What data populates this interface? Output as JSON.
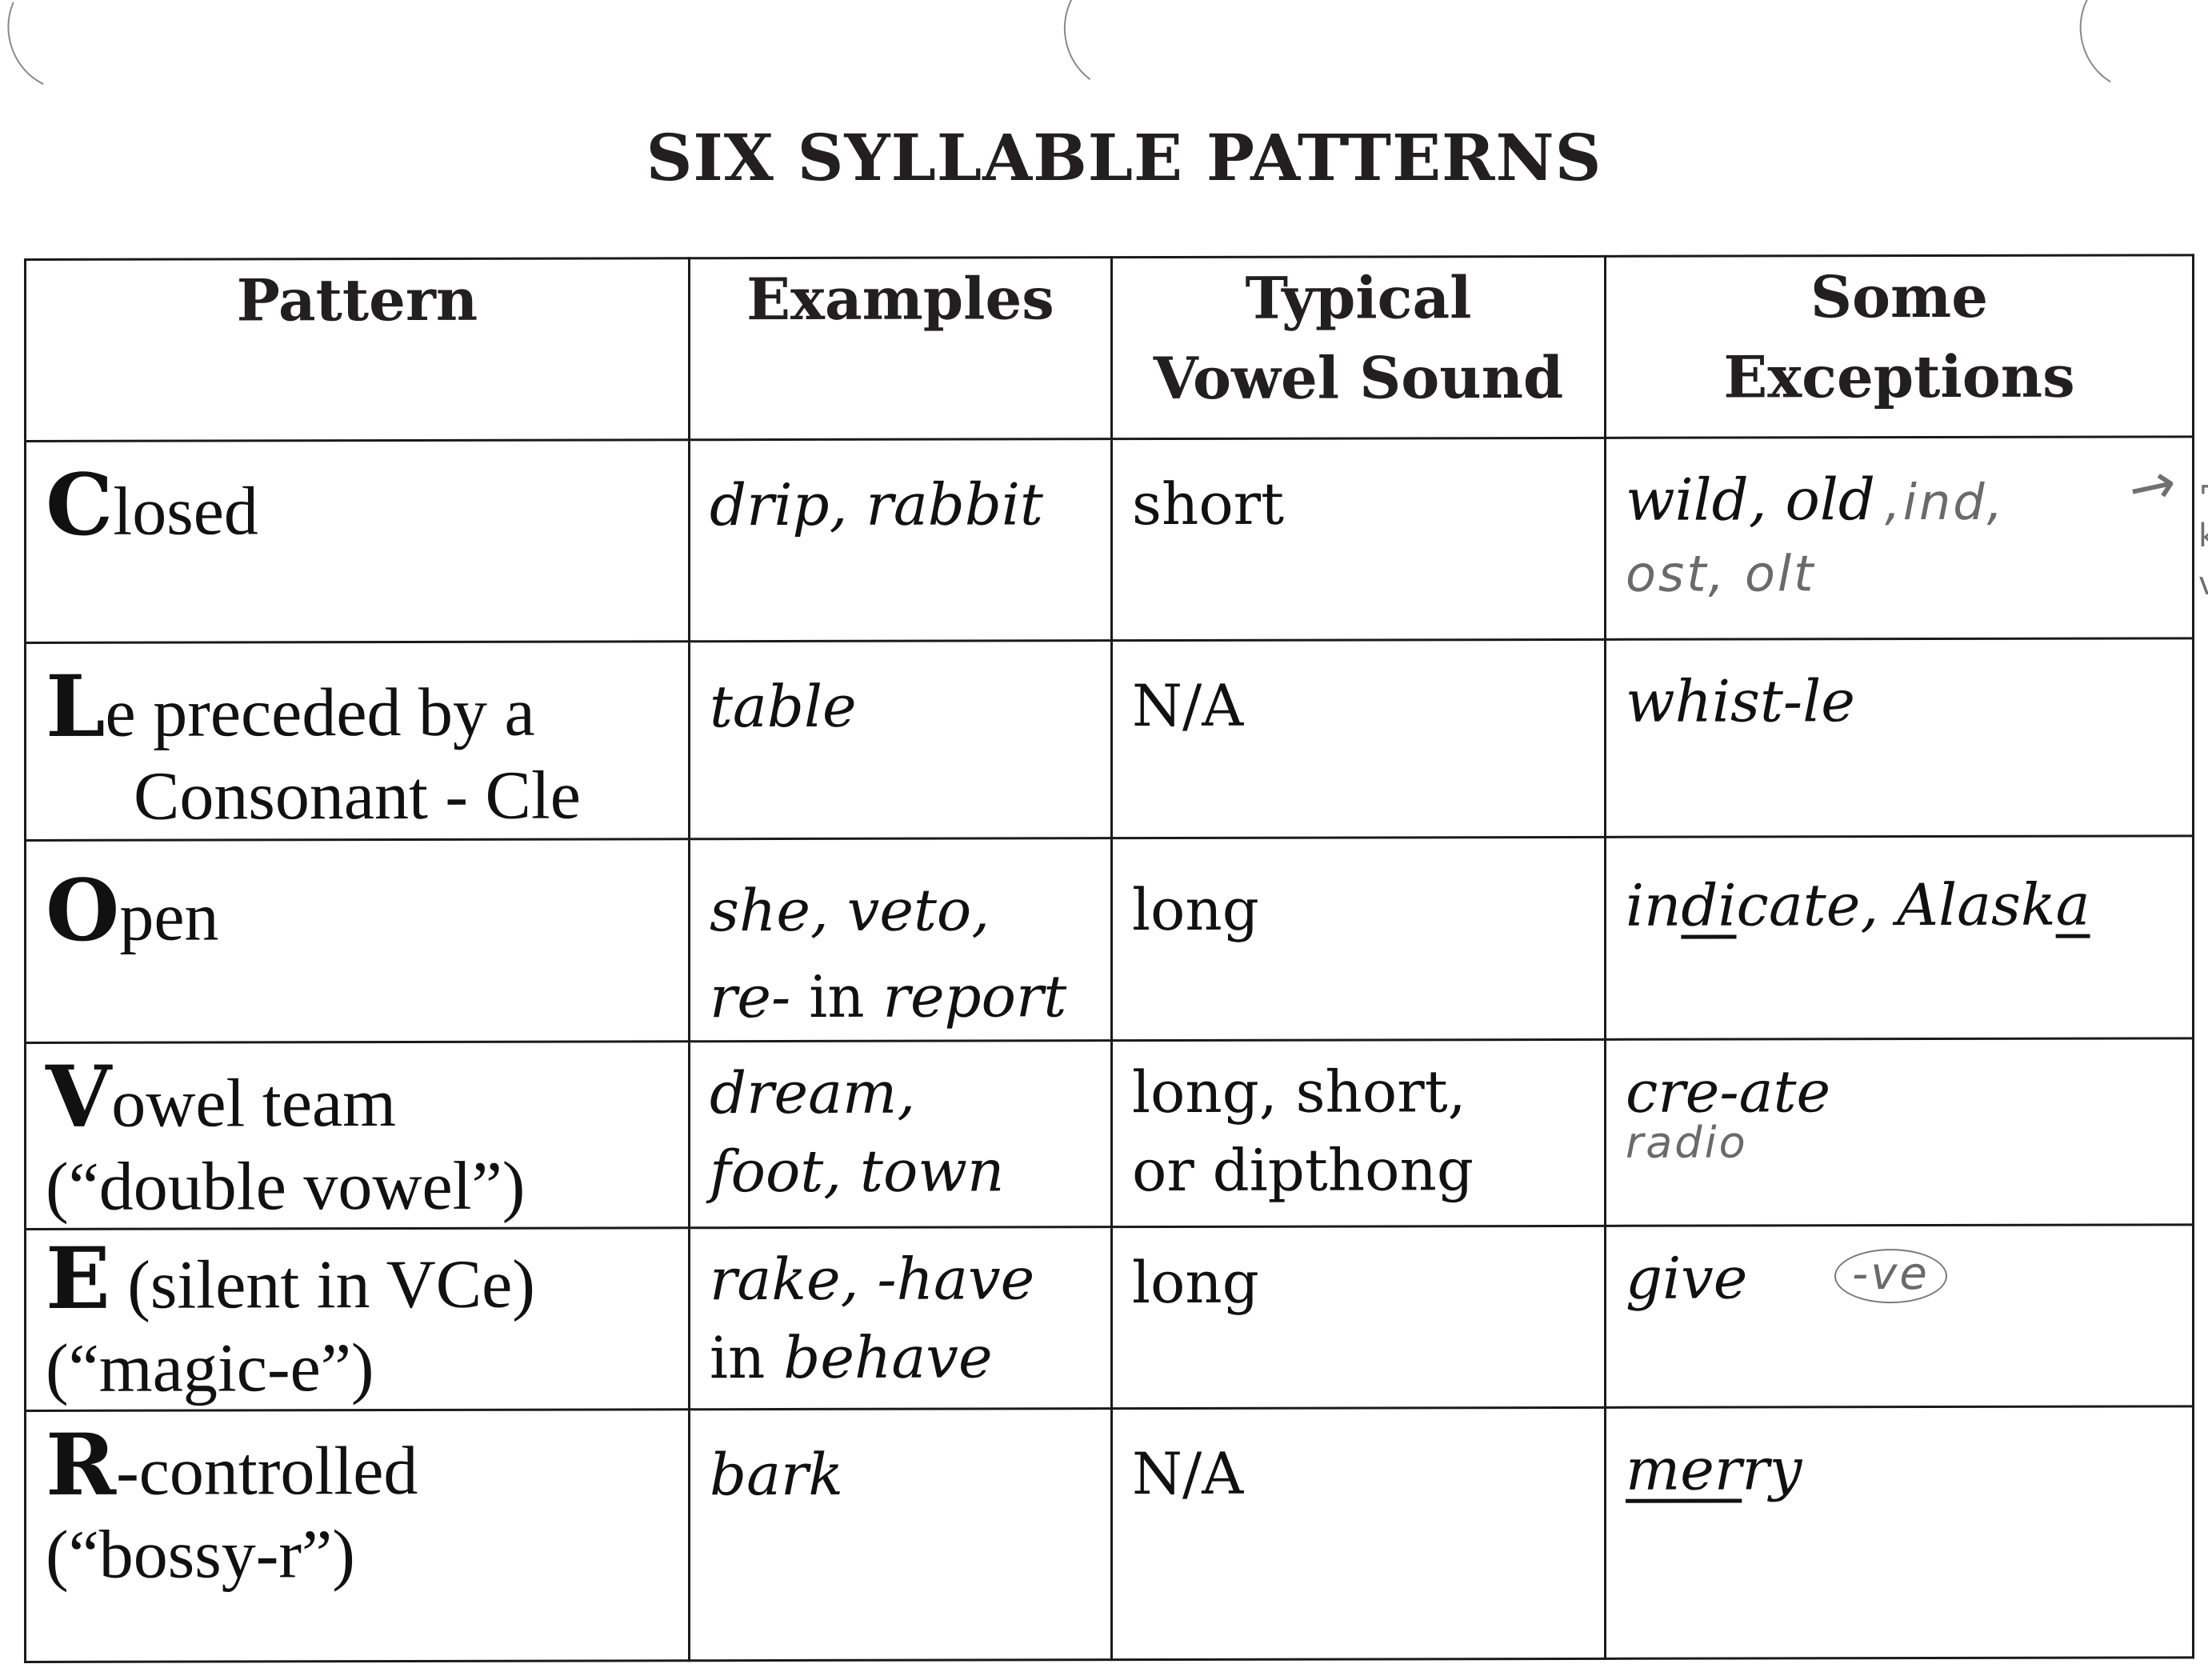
{
  "document": {
    "title": "SIX SYLLABLE PATTERNS",
    "headers": {
      "pattern": "Pattern",
      "examples": "Examples",
      "vowel_line1": "Typical",
      "vowel_line2": "Vowel Sound",
      "exceptions_line1": "Some",
      "exceptions_line2": "Exceptions"
    },
    "rows": [
      {
        "pattern_initial": "C",
        "pattern_rest": "losed",
        "pattern_line2": "",
        "examples_line1": "drip, rabbit",
        "examples_line2": "",
        "vowel_sound_line1": "short",
        "vowel_sound_line2": "",
        "exceptions": "wild, old",
        "handwritten_note_inline": ",ind,",
        "handwritten_note_line2": "ost, olt",
        "handwritten_arrow": "→"
      },
      {
        "pattern_initial": "L",
        "pattern_rest": "e preceded by a",
        "pattern_line2": "Consonant - Cle",
        "examples_line1": "table",
        "vowel_sound_line1": "N/A",
        "exceptions": "whist-le"
      },
      {
        "pattern_initial": "O",
        "pattern_rest": "pen",
        "examples_line1": "she, veto,",
        "examples_line2_italic_a": "re-",
        "examples_line2_plain": " in ",
        "examples_line2_italic_b": "report",
        "vowel_sound_line1": "long",
        "exceptions_parts": [
          "in",
          "di",
          "cate, Alask",
          "a"
        ],
        "exceptions_underlined": [
          "di",
          "a"
        ]
      },
      {
        "pattern_initial": "V",
        "pattern_rest": "owel team",
        "pattern_line2": "(“double vowel”)",
        "examples_line1": "dream,",
        "examples_line2": "foot, town",
        "vowel_sound_line1": "long, short,",
        "vowel_sound_line2": "or dipthong",
        "exceptions": "cre-ate",
        "handwritten_note_line2": "radio"
      },
      {
        "pattern_initial": "E",
        "pattern_rest": " (silent in VCe)",
        "pattern_line2": "(“magic-e”)",
        "examples_line1": "rake, -have",
        "examples_line2_plain": "in ",
        "examples_line2_italic": "behave",
        "vowel_sound_line1": "long",
        "exceptions": "give",
        "handwritten_circled_note": "-ve"
      },
      {
        "pattern_initial": "R",
        "pattern_rest": "-controlled",
        "pattern_line2": "(“bossy-r”)",
        "examples_line1": "bark",
        "vowel_sound_line1": "N/A",
        "exceptions_underlined_part": "mer",
        "exceptions_rest": "ry"
      }
    ],
    "margin_marks": [
      "⌐",
      "k",
      "v"
    ]
  }
}
